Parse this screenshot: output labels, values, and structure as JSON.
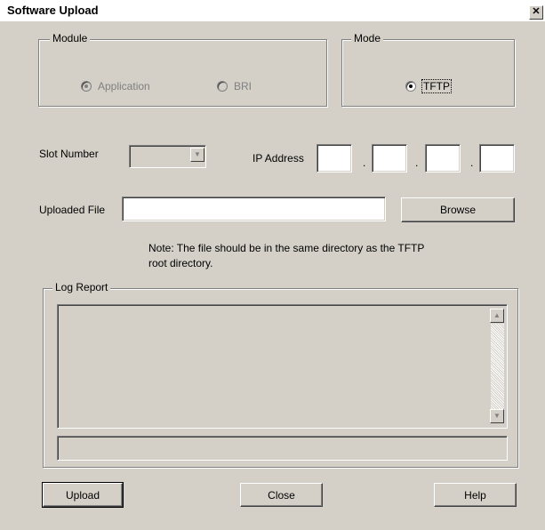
{
  "window": {
    "title": "Software Upload",
    "close_glyph": "✕"
  },
  "module_group": {
    "legend": "Module",
    "options": [
      {
        "label": "Application",
        "selected": true,
        "enabled": false
      },
      {
        "label": "BRI",
        "selected": false,
        "enabled": false
      }
    ]
  },
  "mode_group": {
    "legend": "Mode",
    "options": [
      {
        "label": "TFTP",
        "selected": true,
        "enabled": true
      }
    ]
  },
  "slot": {
    "label": "Slot Number",
    "value": ""
  },
  "ip": {
    "label": "IP Address",
    "octets": [
      "",
      "",
      "",
      ""
    ],
    "separator": "."
  },
  "file": {
    "label": "Uploaded File",
    "value": "",
    "browse_label": "Browse"
  },
  "note": {
    "line1": "Note: The file should be in the same directory as the TFTP",
    "line2": "root directory."
  },
  "log": {
    "legend": "Log Report",
    "text": "",
    "status": ""
  },
  "buttons": {
    "upload": "Upload",
    "close": "Close",
    "help": "Help"
  },
  "colors": {
    "face": "#d4d0c8",
    "shadow": "#808080",
    "highlight": "#ffffff",
    "dark": "#404040"
  }
}
